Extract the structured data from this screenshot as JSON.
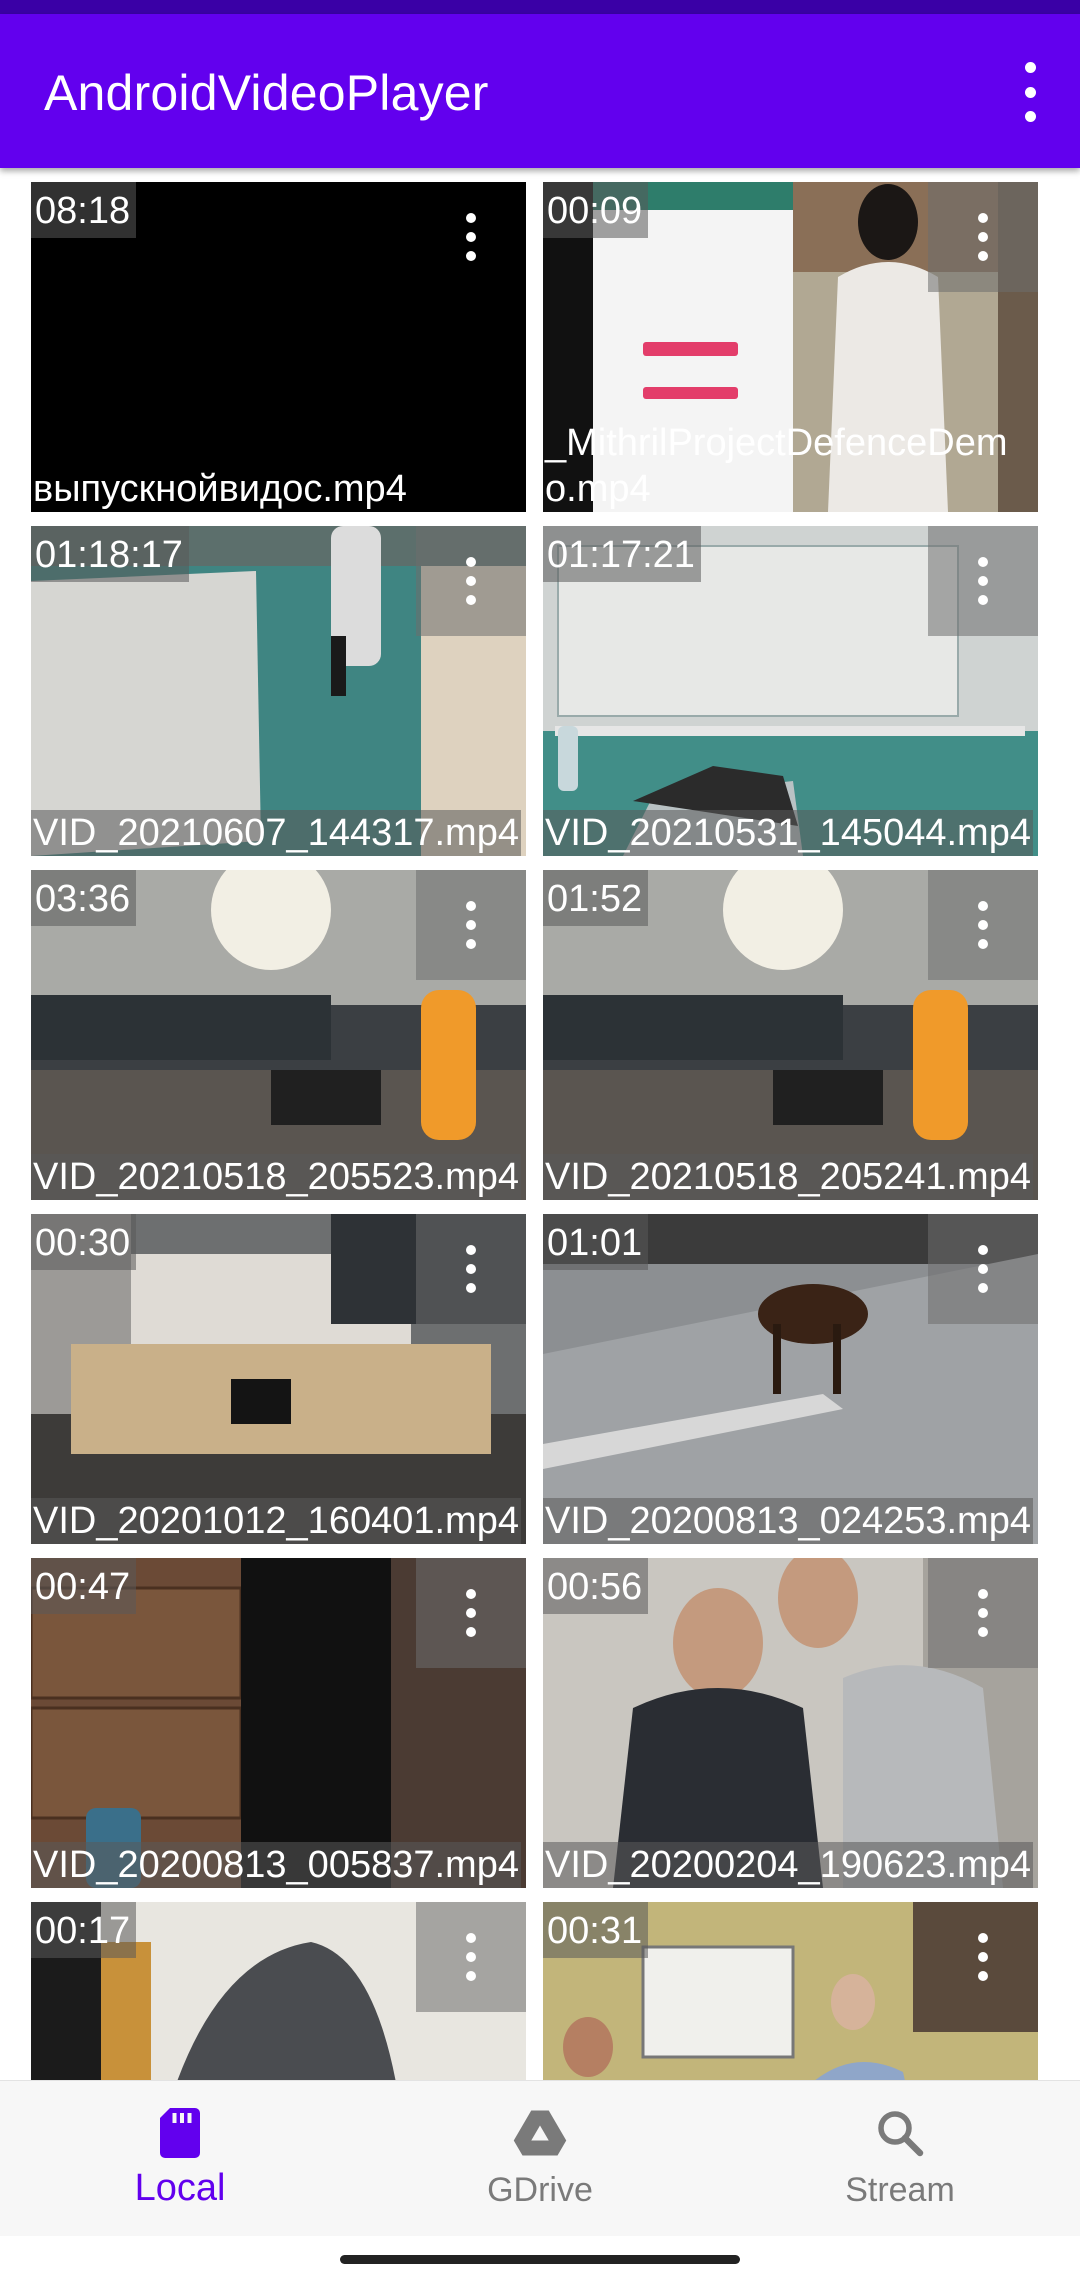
{
  "app_title": "AndroidVideoPlayer",
  "colors": {
    "primary": "#6200ee",
    "status_bar": "#3a00a6",
    "inactive": "#7a7a7a"
  },
  "icons": {
    "overflow": "more-vert-icon",
    "local": "sd-card-icon",
    "gdrive": "google-drive-icon",
    "stream": "search-icon"
  },
  "videos": [
    {
      "duration": "08:18",
      "name": "выпускнойвидос.mp4"
    },
    {
      "duration": "00:09",
      "name": "_MithrilProjectDefenceDemo.mp4"
    },
    {
      "duration": "01:18:17",
      "name": "VID_20210607_144317.mp4"
    },
    {
      "duration": "01:17:21",
      "name": "VID_20210531_145044.mp4"
    },
    {
      "duration": "03:36",
      "name": "VID_20210518_205523.mp4"
    },
    {
      "duration": "01:52",
      "name": "VID_20210518_205241.mp4"
    },
    {
      "duration": "00:30",
      "name": "VID_20201012_160401.mp4"
    },
    {
      "duration": "01:01",
      "name": "VID_20200813_024253.mp4"
    },
    {
      "duration": "00:47",
      "name": "VID_20200813_005837.mp4"
    },
    {
      "duration": "00:56",
      "name": "VID_20200204_190623.mp4"
    },
    {
      "duration": "00:17",
      "name": ""
    },
    {
      "duration": "00:31",
      "name": ""
    }
  ],
  "bottom_nav": [
    {
      "label": "Local",
      "active": true
    },
    {
      "label": "GDrive",
      "active": false
    },
    {
      "label": "Stream",
      "active": false
    }
  ]
}
